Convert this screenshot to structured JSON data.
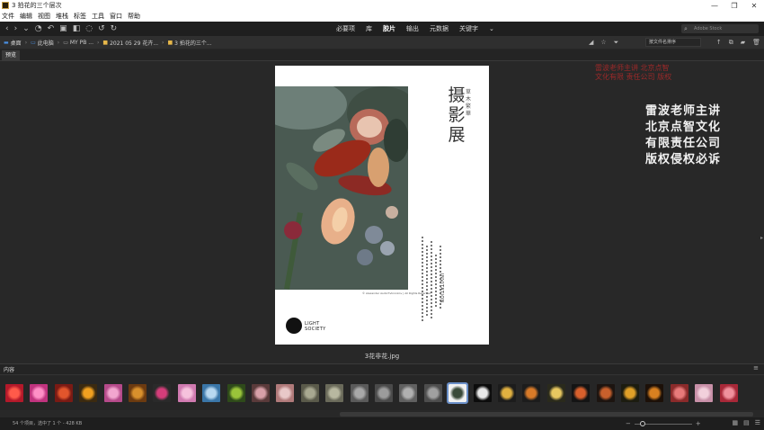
{
  "window": {
    "title": "3 拍花的三个层次",
    "minimize": "—",
    "maximize": "❐",
    "close": "✕"
  },
  "menu": [
    "文件",
    "编辑",
    "视图",
    "堆栈",
    "标签",
    "工具",
    "窗口",
    "帮助"
  ],
  "toolbar": {
    "workspaces": [
      "必要项",
      "库",
      "胶片",
      "输出",
      "元数据",
      "关键字"
    ],
    "active_workspace": "胶片",
    "workspace_more": "⌄",
    "search_placeholder": "Adobe Stock"
  },
  "path": {
    "crumbs": [
      {
        "label": "桌面",
        "icon": "desktop-icon"
      },
      {
        "label": "此电脑",
        "icon": "computer-icon"
      },
      {
        "label": "MY PB ...",
        "icon": "drive-icon"
      },
      {
        "label": "2021 05 29 花卉...",
        "icon": "folder-icon"
      },
      {
        "label": "3 拍花的三个...",
        "icon": "folder-icon"
      }
    ],
    "sort_label": "按文件名排序",
    "sort_arrow": "⌄"
  },
  "preview": {
    "tab": "预览",
    "filename": "3花非花.jpg",
    "poster": {
      "title": "摄影展",
      "subtitle": "草木繁華",
      "invitation": "INVITATION",
      "caption": "© Alexander Asdorf-Voronkov | All Rights Reserved",
      "logo_line1": "LIGHT",
      "logo_line2": "SOCIETY"
    }
  },
  "watermark": {
    "lines": [
      "雷波老师主讲",
      "北京点智文化",
      "有限责任公司",
      "版权侵权必诉"
    ],
    "red_lines": [
      "雷波老师主讲 北京点智",
      "文化有限 责任公司 版权"
    ]
  },
  "content": {
    "tab": "内容",
    "panel_menu": "≡",
    "thumbnails": [
      {
        "color": "#b3192a",
        "accent": "#ff5a4a"
      },
      {
        "color": "#c0337e",
        "accent": "#ff8fc6"
      },
      {
        "color": "#7a1a14",
        "accent": "#e2552c"
      },
      {
        "color": "#3b2a10",
        "accent": "#f0a020"
      },
      {
        "color": "#b54a8a",
        "accent": "#f2a6cf"
      },
      {
        "color": "#6b3a10",
        "accent": "#d8902c"
      },
      {
        "color": "#2a2a2a",
        "accent": "#d43d7a"
      },
      {
        "color": "#d07ab0",
        "accent": "#f6c2dd"
      },
      {
        "color": "#3a76a8",
        "accent": "#b8d8f0"
      },
      {
        "color": "#2e4a1a",
        "accent": "#9ac43a"
      },
      {
        "color": "#5a3a3a",
        "accent": "#d8a0a8"
      },
      {
        "color": "#b07a7a",
        "accent": "#e8c8c8"
      },
      {
        "color": "#5a5a4a",
        "accent": "#a8a890"
      },
      {
        "color": "#6a6a5a",
        "accent": "#b8b8a0"
      },
      {
        "color": "#5a5a5a",
        "accent": "#a8a8a8"
      },
      {
        "color": "#4a4a4a",
        "accent": "#9c9c9c"
      },
      {
        "color": "#606060",
        "accent": "#b0b0b0"
      },
      {
        "color": "#4d4d4d",
        "accent": "#a0a0a0"
      },
      {
        "color": "#f2f2f2",
        "accent": "#3a4a3a",
        "selected": true
      },
      {
        "color": "#0c0c0c",
        "accent": "#e8e8e8"
      },
      {
        "color": "#1c1c1c",
        "accent": "#e0b040"
      },
      {
        "color": "#1c1c1c",
        "accent": "#d87a28"
      },
      {
        "color": "#2a2a1c",
        "accent": "#e8c860"
      },
      {
        "color": "#141414",
        "accent": "#d8602c"
      },
      {
        "color": "#1c1410",
        "accent": "#c8602c"
      },
      {
        "color": "#1c1c10",
        "accent": "#e0a028"
      },
      {
        "color": "#1c1008",
        "accent": "#d88020"
      },
      {
        "color": "#8a2a2a",
        "accent": "#e87a7a"
      },
      {
        "color": "#c890a8",
        "accent": "#f2d0dc"
      },
      {
        "color": "#a82838",
        "accent": "#f0909c"
      }
    ]
  },
  "status": {
    "text": "54 个项目，选中了 1 个 - 428 KB",
    "zoom_minus": "−",
    "zoom_plus": "+",
    "zoom_level": 0.1
  }
}
